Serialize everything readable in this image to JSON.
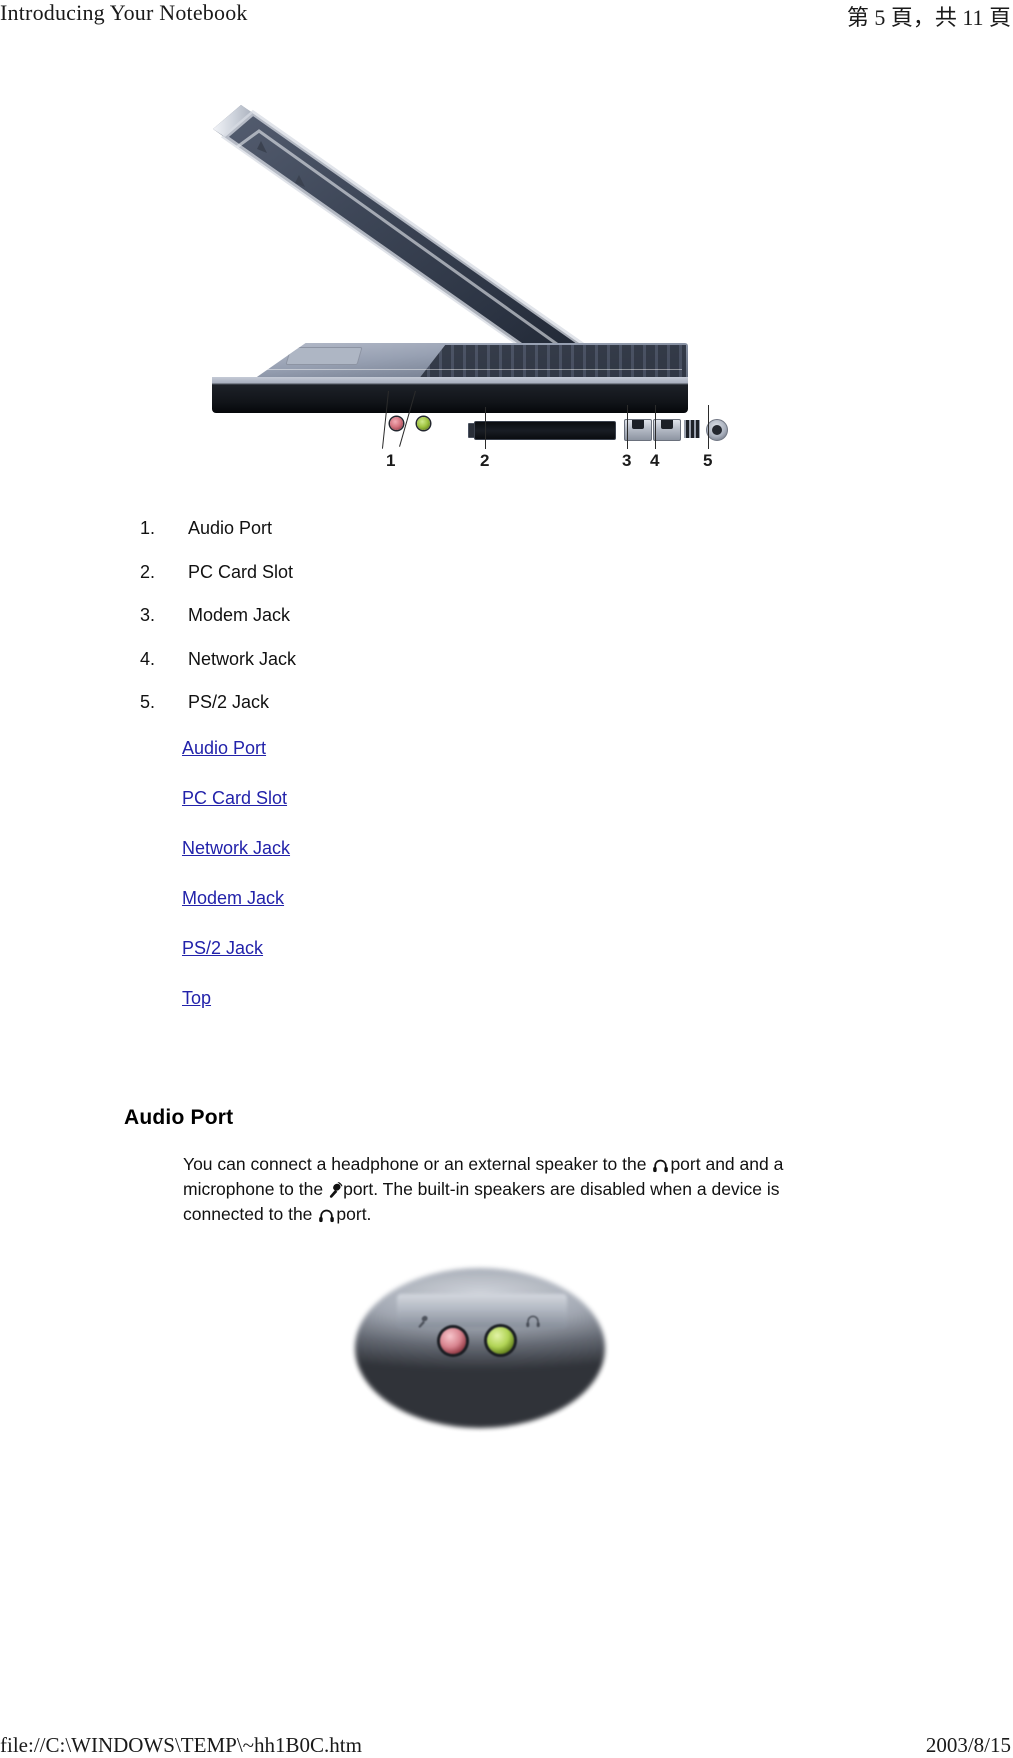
{
  "header": {
    "left_title": "Introducing Your Notebook",
    "right_pagination": "第 5 頁，共 11 頁"
  },
  "figure_main": {
    "alt": "Left side view of an open notebook computer showing audio ports, PC Card slot, modem jack, network jack and PS/2 jack",
    "callouts": [
      "1",
      "2",
      "3",
      "4",
      "5"
    ]
  },
  "numbered_list": [
    {
      "index": "1.",
      "label": "Audio Port"
    },
    {
      "index": "2.",
      "label": "PC Card Slot"
    },
    {
      "index": "3.",
      "label": "Modem Jack"
    },
    {
      "index": "4.",
      "label": "Network Jack"
    },
    {
      "index": "5.",
      "label": "PS/2 Jack"
    }
  ],
  "links": [
    {
      "label": "Audio Port"
    },
    {
      "label": "PC Card Slot"
    },
    {
      "label": "Network Jack"
    },
    {
      "label": "Modem Jack"
    },
    {
      "label": "PS/2 Jack"
    },
    {
      "label": "Top"
    }
  ],
  "audio_port_section": {
    "heading": "Audio Port",
    "body_part_1": "You can connect a headphone or an external speaker to the",
    "body_part_2": "port and and a microphone to the",
    "body_part_3": "port. The built-in speakers are disabled when a device is connected to the",
    "body_part_4": "port.",
    "icon_1": "headphone-icon",
    "icon_2": "microphone-icon",
    "icon_3": "headphone-icon"
  },
  "figure_closeup": {
    "alt": "Close-up photo of the pink microphone jack and green headphone jack on the notebook side panel"
  },
  "footer": {
    "left_path": "file://C:\\WINDOWS\\TEMP\\~hh1B0C.htm",
    "right_date": "2003/8/15"
  },
  "colors": {
    "link": "#2222aa",
    "text": "#111111",
    "mic_jack": "#d4737f",
    "headphone_jack": "#9ec23f"
  }
}
